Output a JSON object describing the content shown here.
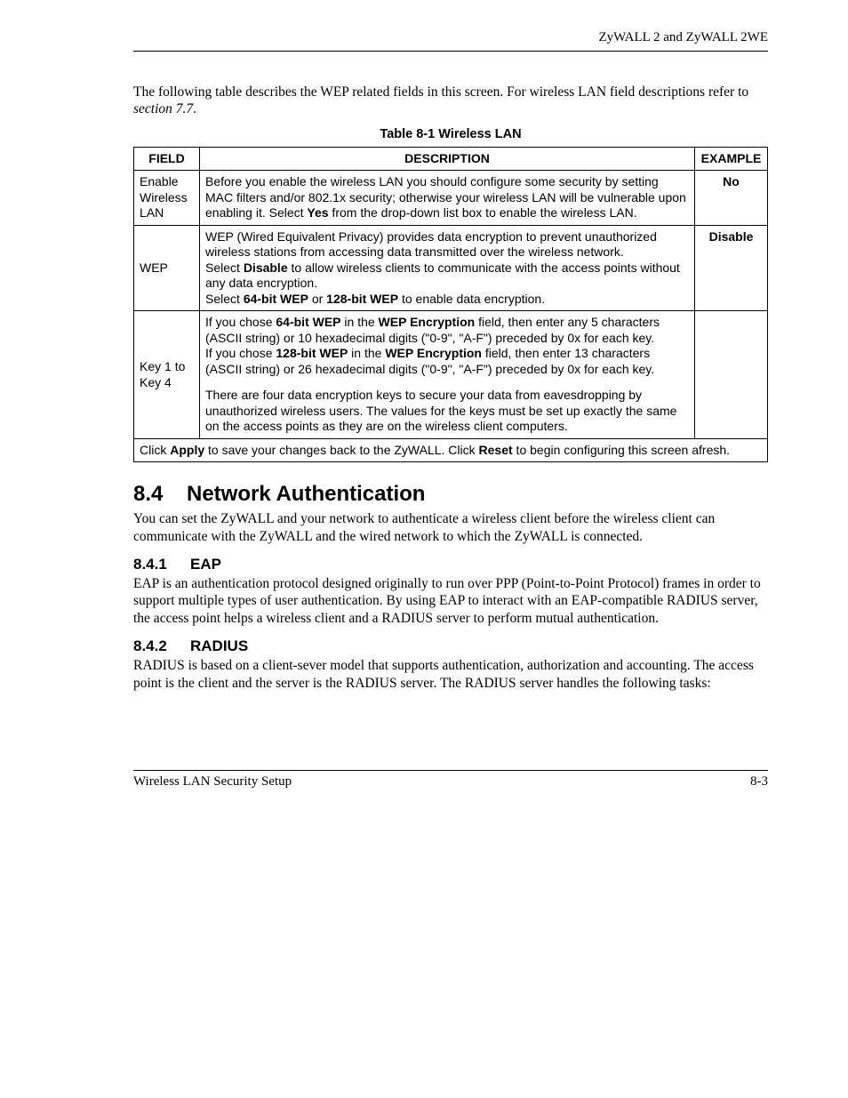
{
  "header": {
    "running": "ZyWALL 2 and ZyWALL 2WE"
  },
  "intro": {
    "lead": "The following table describes the WEP related fields in this screen. For wireless LAN field descriptions refer to ",
    "ref": "section 7.7",
    "tail": "."
  },
  "table": {
    "caption": "Table 8-1 Wireless LAN",
    "headers": {
      "field": "FIELD",
      "description": "DESCRIPTION",
      "example": "EXAMPLE"
    },
    "rows": [
      {
        "field": "Enable Wireless LAN",
        "desc": {
          "pre": "Before you enable the wireless LAN you should configure some security by setting MAC filters and/or 802.1x security; otherwise your wireless LAN will be vulnerable upon enabling it. Select ",
          "b1": "Yes",
          "post": " from the drop-down list box to enable the wireless LAN."
        },
        "example": "No"
      },
      {
        "field": "WEP",
        "desc": {
          "p1": "WEP (Wired Equivalent Privacy) provides data encryption to prevent unauthorized wireless stations from accessing data transmitted over the wireless network.",
          "p2_pre": "Select ",
          "p2_b1": "Disable",
          "p2_mid": " to allow wireless clients to communicate with the access points without any data encryption.",
          "p3_pre": "Select ",
          "p3_b1": "64-bit WEP",
          "p3_mid": " or ",
          "p3_b2": "128-bit WEP",
          "p3_post": " to enable data encryption."
        },
        "example": "Disable"
      },
      {
        "field": "Key 1 to Key 4",
        "desc": {
          "a_pre": "If you chose ",
          "a_b1": "64-bit WEP",
          "a_mid1": " in the ",
          "a_b2": "WEP Encryption",
          "a_mid2": " field, then enter any 5 characters (ASCII string) or 10 hexadecimal digits (\"0-9\", \"A-F\") preceded by 0x for each key.",
          "b_pre": "If you chose ",
          "b_b1": "128-bit WEP",
          "b_mid1": " in the ",
          "b_b2": "WEP Encryption",
          "b_mid2": " field, then enter 13 characters (ASCII string) or 26 hexadecimal digits (\"0-9\", \"A-F\") preceded by 0x for each key.",
          "c": "There are four data encryption keys to secure your data from eavesdropping by unauthorized wireless users. The values for the keys must be set up exactly the same on the access points as they are on the wireless client computers."
        },
        "example": ""
      }
    ],
    "footer": {
      "pre": "Click ",
      "b1": "Apply",
      "mid": " to save your changes back to the ZyWALL. Click ",
      "b2": "Reset",
      "post": " to begin configuring this screen afresh."
    }
  },
  "sections": {
    "s84": {
      "num": "8.4",
      "title": "Network Authentication",
      "body": "You can set the ZyWALL and your network to authenticate a wireless client before the wireless client can communicate with the ZyWALL and the wired network to which the ZyWALL is connected."
    },
    "s841": {
      "num": "8.4.1",
      "title": "EAP",
      "body": "EAP is an authentication protocol designed originally to run over PPP (Point-to-Point Protocol) frames in order to support multiple types of user authentication. By using EAP to interact with an EAP-compatible RADIUS server, the access point helps a wireless client and a RADIUS server to perform mutual authentication."
    },
    "s842": {
      "num": "8.4.2",
      "title": "RADIUS",
      "body": "RADIUS is based on a client-sever model that supports authentication, authorization and accounting. The access point is the client and the server is the RADIUS server. The RADIUS server handles the following tasks:"
    }
  },
  "footer": {
    "left": "Wireless LAN Security Setup",
    "right": "8-3"
  }
}
